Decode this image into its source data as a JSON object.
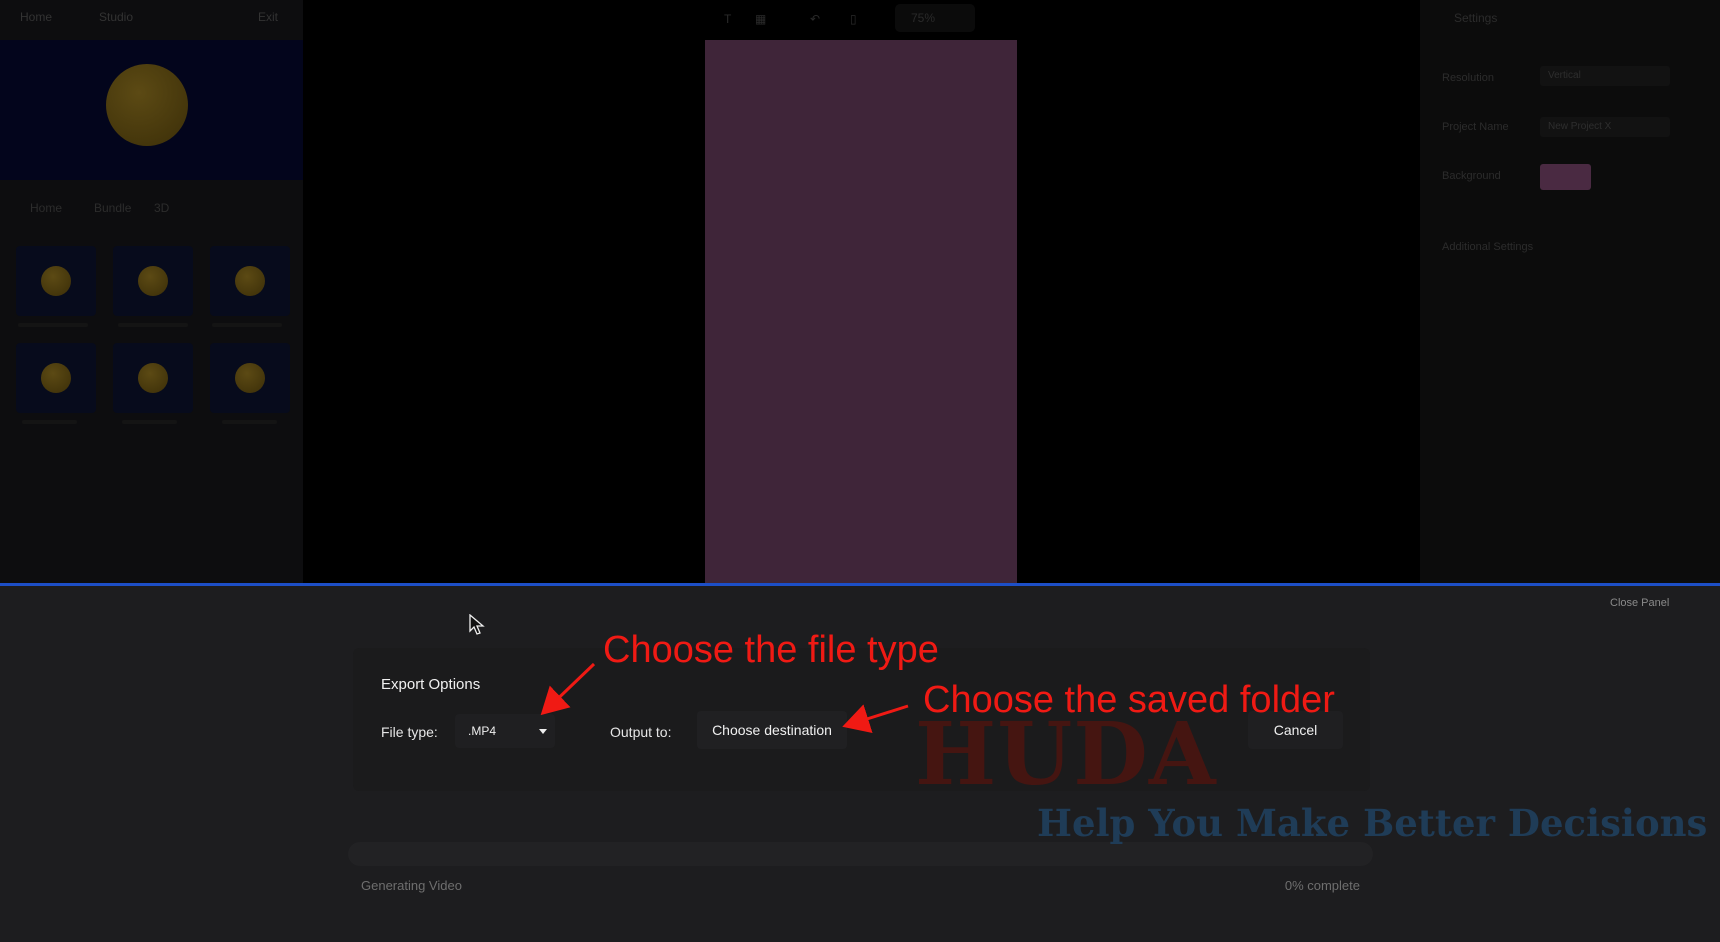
{
  "left_panel": {
    "header_items": [
      "Home",
      "Studio",
      "Exit"
    ],
    "tabs": [
      "Home",
      "Bundle",
      "3D"
    ]
  },
  "toolbar": {
    "zoom": "75%"
  },
  "right_panel": {
    "title": "Settings",
    "rows": [
      {
        "label": "Resolution",
        "value": "Vertical"
      },
      {
        "label": "Project Name",
        "value": "New Project X"
      },
      {
        "label": "Background",
        "value": ""
      }
    ],
    "advanced": "Additional Settings",
    "background_color": "#4a2a42"
  },
  "export_panel": {
    "close_label": "Close Panel",
    "title": "Export Options",
    "file_type_label": "File type:",
    "file_type_value": ".MP4",
    "output_label": "Output to:",
    "destination_button": "Choose destination",
    "cancel_button": "Cancel",
    "progress_label": "Generating Video",
    "progress_percent_label": "0% complete",
    "progress_fraction": 0
  },
  "annotations": {
    "file_type_note": "Choose the file type",
    "folder_note": "Choose the saved folder",
    "watermark": "HUDA",
    "watermark_tagline": "Help You Make Better Decisions"
  },
  "colors": {
    "accent_border": "#1d4fc7",
    "annotation": "#f01a14",
    "canvas": "#3f2539"
  }
}
